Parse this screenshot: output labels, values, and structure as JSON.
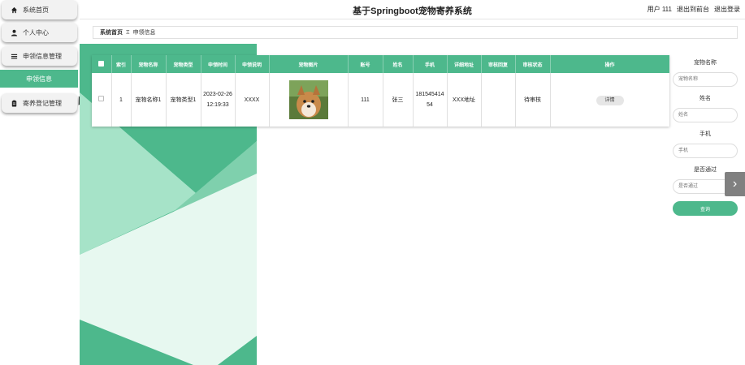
{
  "app": {
    "title": "基于Springboot宠物寄养系统"
  },
  "header": {
    "user": "用户 111",
    "back_to_front": "退出到前台",
    "logout": "退出登录"
  },
  "sidebar": {
    "items": [
      {
        "label": "系统首页",
        "icon": "home-icon"
      },
      {
        "label": "个人中心",
        "icon": "user-icon"
      },
      {
        "label": "申领信息管理",
        "icon": "menu-icon"
      },
      {
        "label": "申领信息",
        "icon": ""
      },
      {
        "label": "寄养登记管理",
        "icon": "clipboard-icon"
      }
    ]
  },
  "breadcrumb": {
    "home": "系统首页",
    "separator": "Ξ",
    "current": "申领信息"
  },
  "table": {
    "headers": [
      "",
      "索引",
      "宠物名称",
      "宠物类型",
      "申领时间",
      "申领说明",
      "宠物图片",
      "账号",
      "姓名",
      "手机",
      "详细地址",
      "审核回复",
      "审核状态",
      "操作"
    ],
    "rows": [
      {
        "index": "1",
        "pet_name": "宠物名称1",
        "pet_type": "宠物类型1",
        "apply_time": "2023-02-26 12:19:33",
        "apply_note": "XXXX",
        "account": "111",
        "name": "张三",
        "phone": "18154541454",
        "address": "XXX地址",
        "review_reply": "",
        "review_status": "待审核",
        "action": "详情"
      }
    ]
  },
  "search": {
    "pet_name_label": "宠物名称",
    "pet_name_placeholder": "宠物名称",
    "name_label": "姓名",
    "name_placeholder": "姓名",
    "phone_label": "手机",
    "phone_placeholder": "手机",
    "passed_label": "是否通过",
    "passed_placeholder": "是否通过",
    "button": "查询"
  },
  "colors": {
    "accent": "#4db88c",
    "accent_light": "#a8e6cf",
    "sidebar_bg": "#f2f2f2"
  },
  "side_arrow_icon": "chevron-right-icon"
}
